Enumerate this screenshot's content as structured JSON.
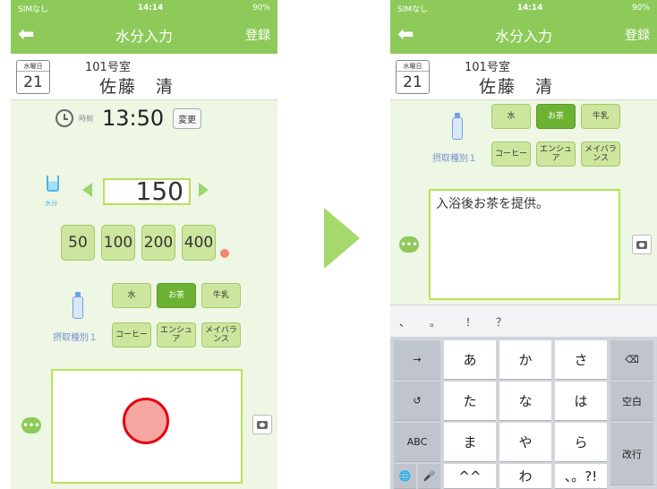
{
  "left": {
    "status": {
      "carrier": "SIMなし",
      "time": "14:14",
      "battery": "90%"
    },
    "nav": {
      "back": "⬅",
      "title": "水分入力",
      "register": "登録"
    },
    "header": {
      "weekday": "水曜日",
      "day": "21",
      "room": "101号室",
      "name": "佐藤　清"
    },
    "time_row": {
      "label": "時刻",
      "value": "13:50",
      "change": "変更"
    },
    "water": {
      "icon_caption": "水分",
      "amount": "150"
    },
    "quick_amounts": [
      "50",
      "100",
      "200",
      "400"
    ],
    "intake": {
      "label": "摂取種別１",
      "types": [
        "水",
        "お茶",
        "牛乳",
        "コーヒー",
        "エンシュア",
        "メイバランス"
      ],
      "selected": "お茶"
    }
  },
  "right": {
    "status": {
      "carrier": "SIMなし",
      "time": "14:14",
      "battery": "90%"
    },
    "nav": {
      "back": "⬅",
      "title": "水分入力",
      "register": "登録"
    },
    "header": {
      "weekday": "水曜日",
      "day": "21",
      "room": "101号室",
      "name": "佐藤　清"
    },
    "intake": {
      "label": "摂取種別１",
      "types": [
        "水",
        "お茶",
        "牛乳",
        "コーヒー",
        "エンシュア",
        "メイバランス"
      ],
      "selected": "お茶"
    },
    "memo": "入浴後お茶を提供。",
    "suggestions": [
      "、",
      "。",
      "！",
      "？"
    ],
    "keyboard": {
      "row1": [
        "→",
        "あ",
        "か",
        "さ",
        "⌫"
      ],
      "row2": [
        "↺",
        "た",
        "な",
        "は",
        "空白"
      ],
      "row3": [
        "ABC",
        "ま",
        "や",
        "ら",
        "改行"
      ],
      "row4": [
        "🌐",
        "🎤",
        "^^",
        "わ",
        "、。?!"
      ]
    }
  },
  "colors": {
    "accent": "#8dca5a",
    "selected": "#6cb233",
    "button": "#cde69e",
    "record": "#e60012"
  }
}
